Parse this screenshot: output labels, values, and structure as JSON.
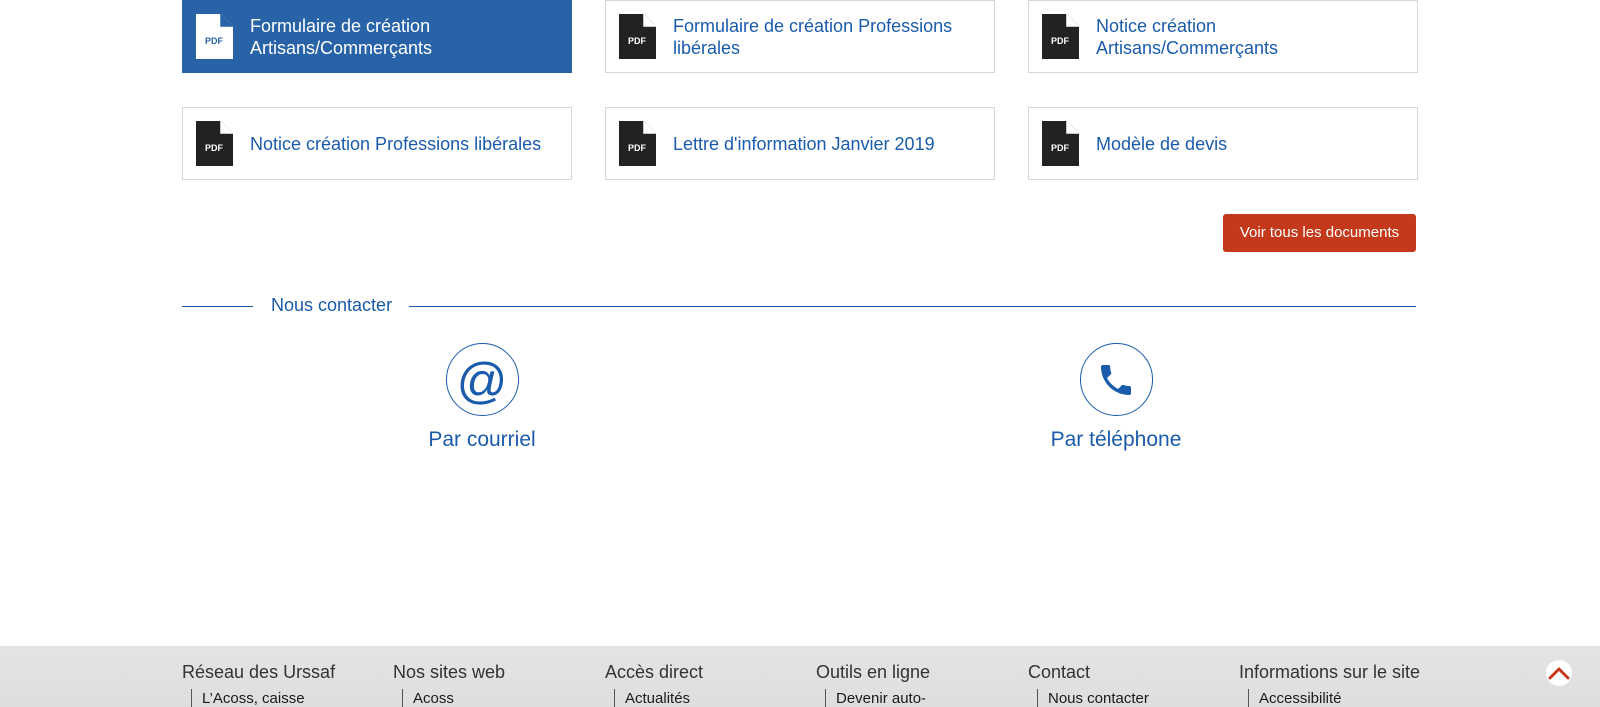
{
  "documents": [
    {
      "label": "Formulaire de création Artisans/Commerçants",
      "icon": "pdf-icon",
      "active": true
    },
    {
      "label": "Formulaire de création Professions libérales",
      "icon": "pdf-icon"
    },
    {
      "label": "Notice création Artisans/Commerçants",
      "icon": "pdf-icon"
    },
    {
      "label": "Notice création Professions libérales",
      "icon": "pdf-icon"
    },
    {
      "label": "Lettre d'information Janvier 2019",
      "icon": "pdf-icon"
    },
    {
      "label": "Modèle de devis",
      "icon": "pdf-icon"
    }
  ],
  "pdf_badge": "PDF",
  "see_all_button": "Voir tous les documents",
  "contact": {
    "title": "Nous contacter",
    "items": [
      {
        "label": "Par courriel",
        "icon": "at-sign-icon"
      },
      {
        "label": "Par téléphone",
        "icon": "phone-icon"
      }
    ]
  },
  "footer": {
    "columns": [
      {
        "heading": "Réseau des Urssaf",
        "link": "L’Acoss, caisse"
      },
      {
        "heading": "Nos sites web",
        "link": "Acoss"
      },
      {
        "heading": "Accès direct",
        "link": "Actualités"
      },
      {
        "heading": "Outils en ligne",
        "link": "Devenir auto-"
      },
      {
        "heading": "Contact",
        "link": "Nous contacter"
      },
      {
        "heading": "Informations sur le site",
        "link": "Accessibilité"
      }
    ],
    "back_to_top_icon": "chevron-up-icon"
  },
  "colors": {
    "brand_blue": "#1a5bab",
    "active_card": "#2863a8",
    "cta_red": "#c4391b",
    "footer_bg": "#e2e2e2"
  }
}
